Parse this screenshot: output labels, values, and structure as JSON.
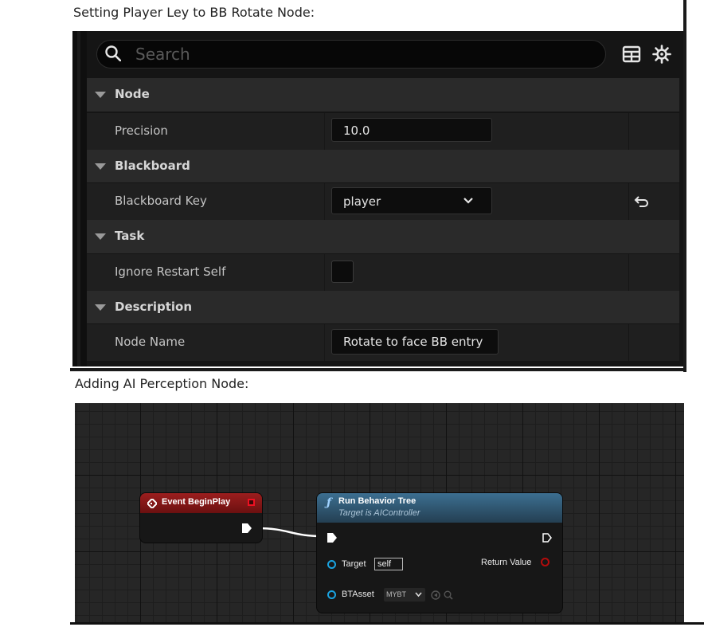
{
  "captions": {
    "first": "Setting Player Ley to BB Rotate Node:",
    "second": "Adding AI Perception Node:"
  },
  "details": {
    "search_placeholder": "Search",
    "categories": [
      {
        "label": "Node"
      },
      {
        "label": "Blackboard"
      },
      {
        "label": "Task"
      },
      {
        "label": "Description"
      }
    ],
    "properties": {
      "precision": {
        "label": "Precision",
        "value": "10.0"
      },
      "blackboard_key": {
        "label": "Blackboard Key",
        "value": "player"
      },
      "ignore_restart_self": {
        "label": "Ignore Restart Self",
        "checked": false
      },
      "node_name": {
        "label": "Node Name",
        "value": "Rotate to face BB entry"
      }
    }
  },
  "graph": {
    "event_node": {
      "title": "Event BeginPlay",
      "color": "#9c1e1e"
    },
    "run_node": {
      "title": "Run Behavior Tree",
      "subtitle": "Target is AIController",
      "color": "#3c6f91",
      "pins": {
        "target_label": "Target",
        "target_value": "self",
        "btasset_label": "BTAsset",
        "btasset_value": "MYBT",
        "return_label": "Return Value"
      }
    }
  },
  "colors": {
    "object_pin": "#1aa3e0",
    "return_pin": "#b30c0c"
  }
}
